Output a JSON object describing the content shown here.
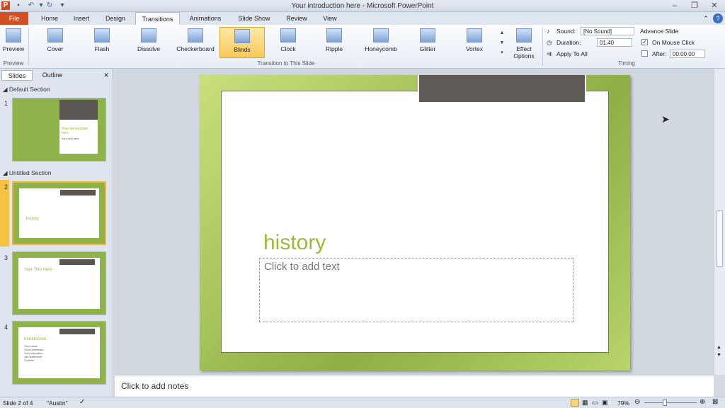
{
  "window": {
    "title": "Your introduction here - Microsoft PowerPoint"
  },
  "tabs": {
    "file": "File",
    "home": "Home",
    "insert": "Insert",
    "design": "Design",
    "transitions": "Transitions",
    "animations": "Animations",
    "slideshow": "Slide Show",
    "review": "Review",
    "view": "View"
  },
  "ribbon": {
    "preview": "Preview",
    "preview_group": "Preview",
    "transitions": [
      "Cover",
      "Flash",
      "Dissolve",
      "Checkerboard",
      "Blinds",
      "Clock",
      "Ripple",
      "Honeycomb",
      "Glitter",
      "Vortex"
    ],
    "selected_transition": "Blinds",
    "effect_options_1": "Effect",
    "effect_options_2": "Options",
    "group_label": "Transition to This Slide",
    "sound_label": "Sound:",
    "sound_value": "[No Sound]",
    "duration_label": "Duration:",
    "duration_value": "01.40",
    "apply_all": "Apply To All",
    "advance_slide": "Advance Slide",
    "on_mouse_click": "On Mouse Click",
    "after_label": "After:",
    "after_value": "00:00.00",
    "timing_group": "Timing"
  },
  "pane": {
    "slides_tab": "Slides",
    "outline_tab": "Outline",
    "section1": "Default Section",
    "section2": "Untitled Section",
    "thumbs": [
      {
        "num": "1",
        "text": "Your introduction here",
        "sub": "Your text here"
      },
      {
        "num": "2",
        "text": "history"
      },
      {
        "num": "3",
        "text": "Your Title Here"
      },
      {
        "num": "4",
        "text": "Introduction",
        "bullets": [
          "Your name",
          "Your hometown",
          "Your education",
          "Job statement",
          "Contact"
        ]
      }
    ]
  },
  "slide": {
    "title": "history",
    "placeholder": "Click to add text"
  },
  "notes": {
    "placeholder": "Click to add notes"
  },
  "status": {
    "slide": "Slide 2 of 4",
    "theme": "\"Austin\"",
    "zoom": "79%"
  }
}
